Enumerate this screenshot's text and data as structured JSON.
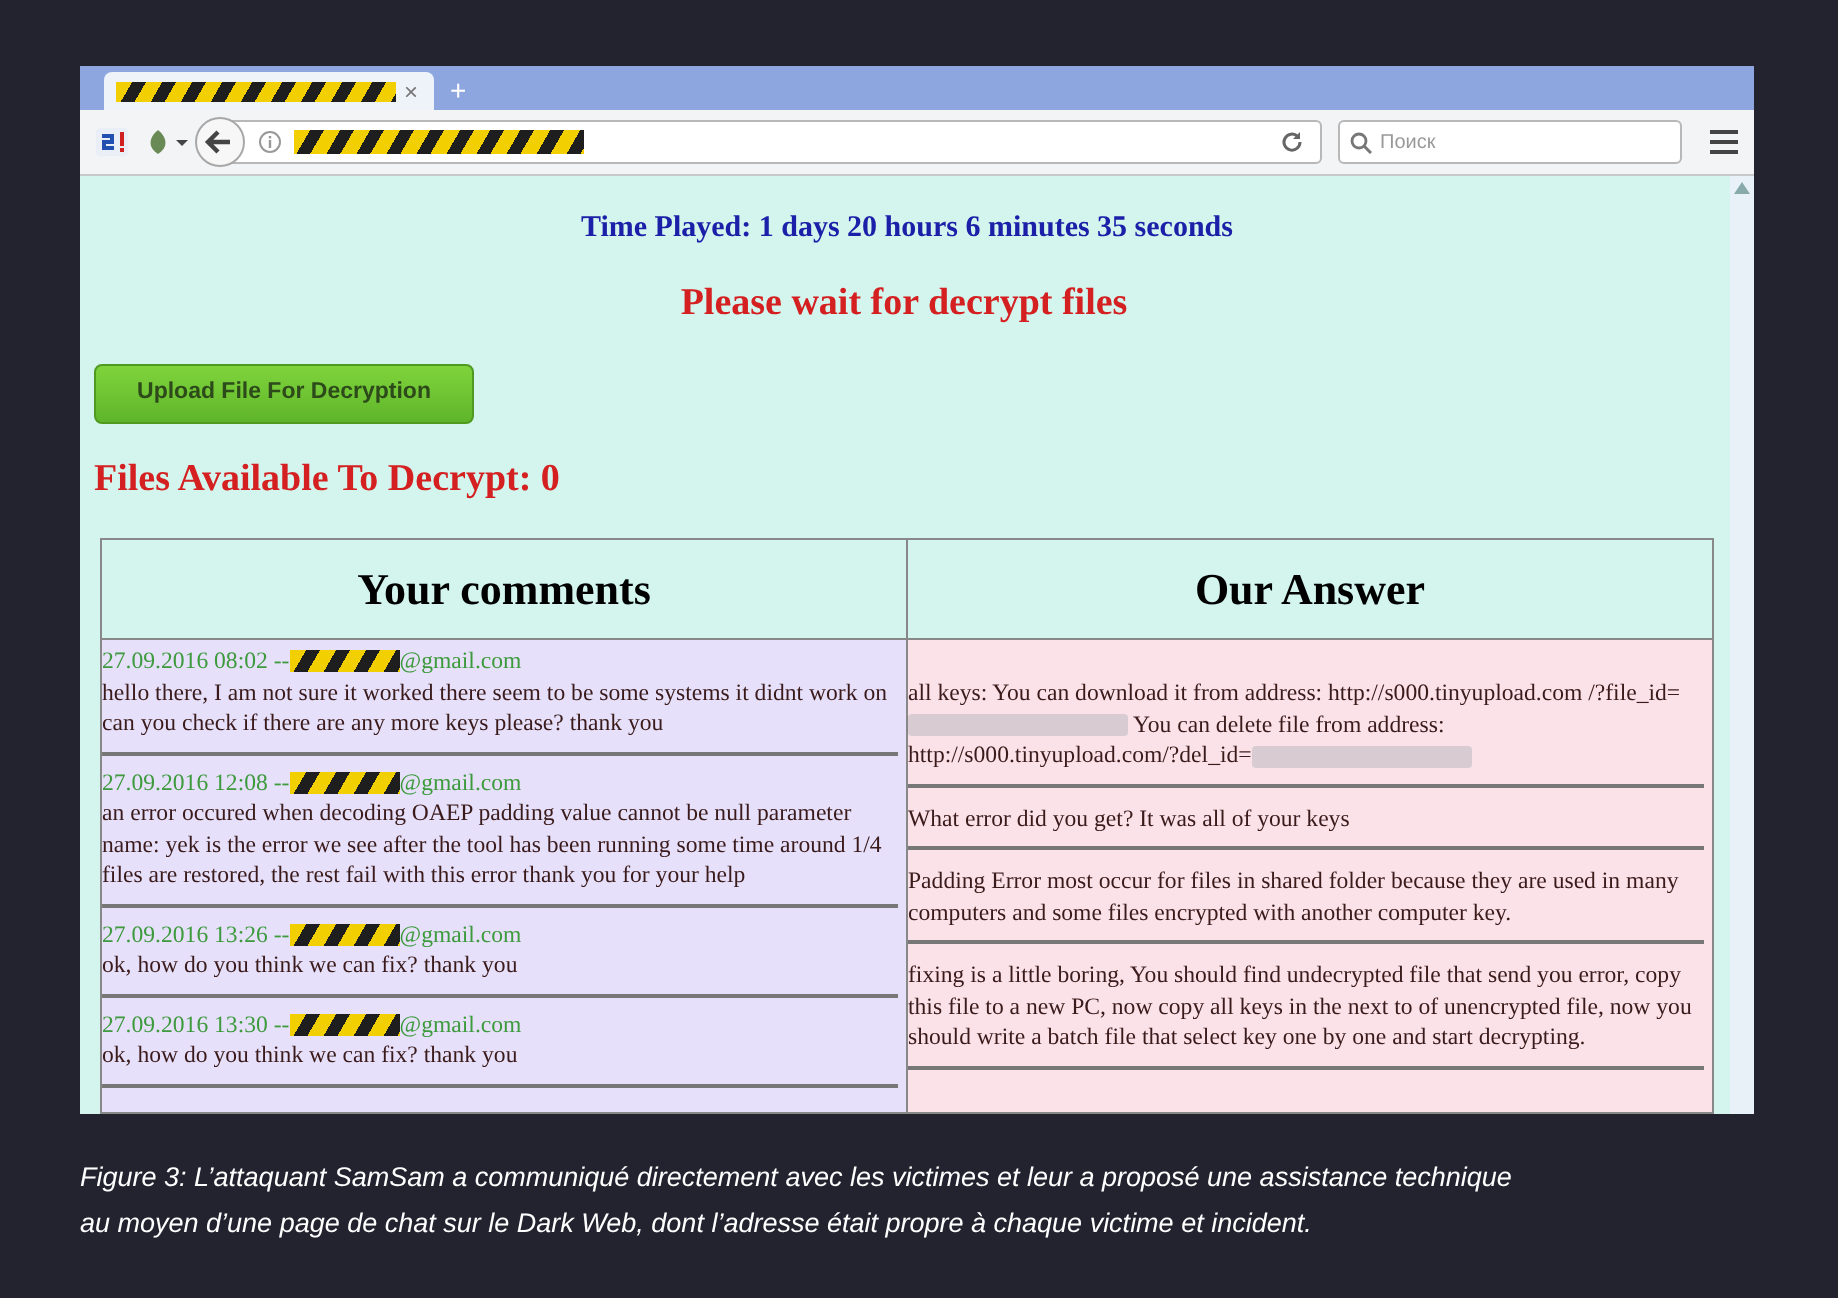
{
  "browser": {
    "tab_close": "×",
    "tab_new": "+",
    "search": {
      "placeholder": "Поиск"
    }
  },
  "page": {
    "time_played": "Time Played: 1 days 20 hours 6 minutes 35 seconds",
    "status": "Please wait for decrypt files",
    "upload_button": "Upload File For Decryption",
    "files_available": "Files Available To Decrypt: 0",
    "table": {
      "columns": [
        "Your comments",
        "Our Answer"
      ],
      "comments": [
        {
          "time": "27.09.2016 08:02 --",
          "email_suffix": "@gmail.com",
          "text": "hello there, I am not sure it worked there seem to be some systems it didnt work on can you check if there are any more keys please? thank you"
        },
        {
          "time": "27.09.2016 12:08 --",
          "email_suffix": "@gmail.com",
          "text": "an error occured when decoding OAEP padding value cannot be null parameter name: yek is the error we see after the tool has been running some time around 1/4 files are restored, the rest fail with this error thank you for your help"
        },
        {
          "time": "27.09.2016 13:26 --",
          "email_suffix": "@gmail.com",
          "text": "ok, how do you think we can fix? thank you"
        },
        {
          "time": "27.09.2016 13:30 --",
          "email_suffix": "@gmail.com",
          "text": "ok, how do you think we can fix? thank you"
        }
      ],
      "answers": [
        {
          "segments": [
            {
              "kind": "text",
              "text": "all keys: You can download it from address: http://s000.tinyupload.com /?file_id="
            },
            {
              "kind": "blur"
            },
            {
              "kind": "text",
              "text": " You can delete file from address: http://s000.tinyupload.com/?del_id="
            },
            {
              "kind": "blur"
            }
          ]
        },
        {
          "segments": [
            {
              "kind": "text",
              "text": "What error did you get? It was all of your keys"
            }
          ]
        },
        {
          "segments": [
            {
              "kind": "text",
              "text": "Padding Error most occur for files in shared folder because they are used in many computers and some files encrypted with another computer key."
            }
          ]
        },
        {
          "segments": [
            {
              "kind": "text",
              "text": "fixing is a little boring, You should find undecrypted file that send you error, copy this file to a new PC, now copy all keys in the next to of unencrypted file, now you should write a batch file that select key one by one and start decrypting."
            }
          ]
        }
      ]
    }
  },
  "caption": "Figure 3: L’attaquant SamSam a communiqué directement avec les victimes et leur a proposé une assistance technique au moyen d’une page de chat sur le Dark Web, dont l’adresse était propre à chaque victime et incident."
}
